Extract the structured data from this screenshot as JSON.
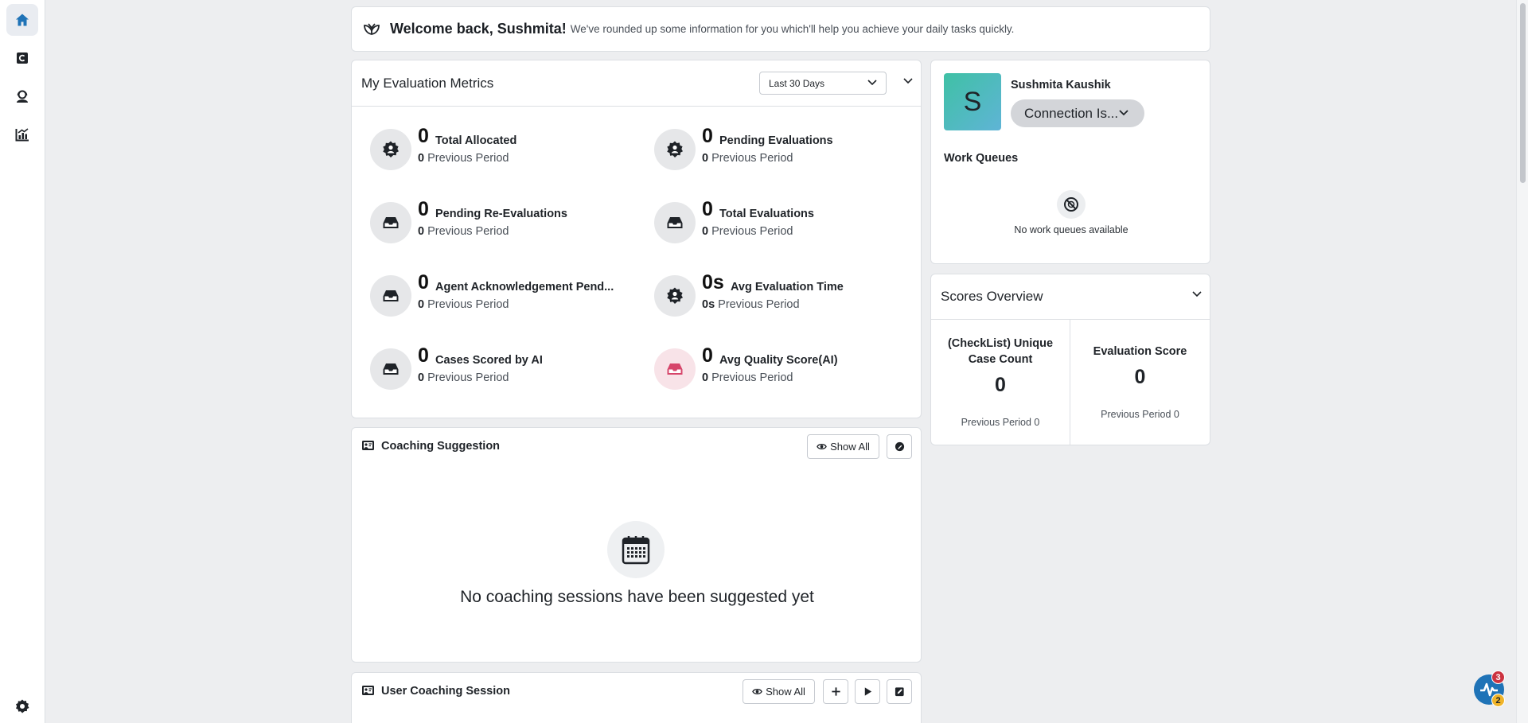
{
  "nav": {
    "items": [
      {
        "name": "home-icon",
        "active": true
      },
      {
        "name": "cases-icon",
        "active": false
      },
      {
        "name": "agent-icon",
        "active": false
      },
      {
        "name": "analytics-icon",
        "active": false
      }
    ],
    "settings": "settings-icon"
  },
  "welcome": {
    "greeting": "Welcome back, Sushmita!",
    "subtitle": "We've rounded up some information for you which'll help you achieve your daily tasks quickly."
  },
  "metrics": {
    "title": "My Evaluation Metrics",
    "range": "Last 30 Days",
    "prev_label": "Previous Period",
    "items": [
      {
        "value": "0",
        "label": "Total Allocated",
        "prev": "0",
        "icon": "gear-badge-icon"
      },
      {
        "value": "0",
        "label": "Pending Evaluations",
        "prev": "0",
        "icon": "gear-badge-icon"
      },
      {
        "value": "0",
        "label": "Pending Re-Evaluations",
        "prev": "0",
        "icon": "inbox-icon"
      },
      {
        "value": "0",
        "label": "Total Evaluations",
        "prev": "0",
        "icon": "inbox-icon"
      },
      {
        "value": "0",
        "label": "Agent Acknowledgement Pend...",
        "prev": "0",
        "icon": "inbox-icon"
      },
      {
        "value": "0s",
        "label": "Avg Evaluation Time",
        "prev": "0s",
        "icon": "gear-badge-icon"
      },
      {
        "value": "0",
        "label": "Cases Scored by AI",
        "prev": "0",
        "icon": "inbox-icon"
      },
      {
        "value": "0",
        "label": "Avg Quality Score(AI)",
        "prev": "0",
        "icon": "inbox-icon",
        "accent": "#d6456a"
      }
    ]
  },
  "profile": {
    "initial": "S",
    "name": "Sushmita Kaushik",
    "status": "Connection Is...",
    "work_queues_title": "Work Queues",
    "work_queues_empty": "No work queues available"
  },
  "scores": {
    "title": "Scores Overview",
    "left": {
      "title": "(CheckList) Unique Case Count",
      "value": "0",
      "prev": "Previous Period 0"
    },
    "right": {
      "title": "Evaluation Score",
      "value": "0",
      "prev": "Previous Period 0"
    }
  },
  "coaching": {
    "title": "Coaching Suggestion",
    "show_all": "Show All",
    "empty": "No coaching sessions have been suggested yet"
  },
  "user_coaching": {
    "title": "User Coaching Session",
    "show_all": "Show All"
  },
  "notifications": {
    "red": "3",
    "yellow": "2"
  },
  "colors": {
    "accent": "#1f73b7",
    "danger": "#cc3340",
    "warning": "#f0b429"
  }
}
